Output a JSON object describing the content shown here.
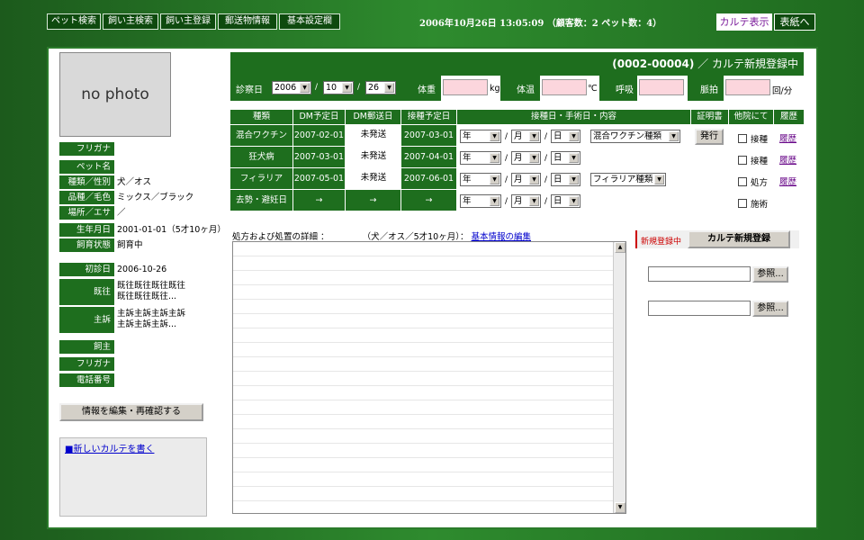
{
  "nav": {
    "tabs": [
      "ペット検索",
      "飼い主検索",
      "飼い主登録",
      "郵送物情報",
      "基本設定欄"
    ],
    "datetime": "2006年10月26日 13:05:09 （顧客数：2 ペット数：4）",
    "karte_view": "カルテ表示",
    "to_cover": "表紙へ"
  },
  "pet": {
    "photo_text": "no photo",
    "labels": [
      "フリガナ",
      "ペット名",
      "種類／性別",
      "品種／毛色",
      "場所／エサ",
      "生年月日",
      "飼育状態"
    ],
    "values": [
      "",
      "",
      "犬／オス",
      "ミックス／ブラック",
      "／",
      "2001-01-01（5才10ヶ月）",
      "飼育中"
    ],
    "visit_labels": [
      "初診日",
      "既往",
      "主訴"
    ],
    "first_visit": "2006-10-26",
    "history_lines": [
      "既往既往既往既往",
      "既往既往既往..."
    ],
    "complaint_lines": [
      "主訴主訴主訴主訴",
      "主訴主訴主訴..."
    ]
  },
  "owner": {
    "labels": [
      "飼主",
      "フリガナ",
      "電話番号"
    ]
  },
  "edit_button": "情報を編集・再確認する",
  "new_karte_link": "■新しいカルテを書く",
  "header": {
    "code": "(0002-00004)",
    "status": "／ カルテ新規登録中"
  },
  "vitals": {
    "date_label": "診察日",
    "year": "2006",
    "month": "10",
    "day": "26",
    "weight_label": "体重",
    "weight_unit": "kg",
    "temp_label": "体温",
    "temp_unit": "℃",
    "resp_label": "呼吸",
    "pulse_label": "脈拍",
    "pulse_unit": "回/分"
  },
  "table": {
    "headers": [
      "種類",
      "DM予定日",
      "DM郵送日",
      "接種予定日",
      "接種日・手術日・内容",
      "証明書",
      "他院にて",
      "履歴"
    ],
    "rows": [
      {
        "type": "混合ワクチン",
        "dm_planned": "2007-02-01",
        "dm_sent": "未発送",
        "vacc_planned": "2007-03-01",
        "extra": "混合ワクチン種類",
        "cert": "発行",
        "other": "接種",
        "history": "履歴"
      },
      {
        "type": "狂犬病",
        "dm_planned": "2007-03-01",
        "dm_sent": "未発送",
        "vacc_planned": "2007-04-01",
        "extra": "",
        "cert": "",
        "other": "接種",
        "history": "履歴"
      },
      {
        "type": "フィラリア",
        "dm_planned": "2007-05-01",
        "dm_sent": "未発送",
        "vacc_planned": "2007-06-01",
        "extra": "フィラリア種類",
        "cert": "",
        "other": "処方",
        "history": "履歴"
      },
      {
        "type": "去勢・避妊日",
        "dm_planned": "→",
        "dm_sent": "→",
        "vacc_planned": "→",
        "extra": "",
        "cert": "",
        "other": "施術",
        "history": ""
      }
    ],
    "date_y": "年",
    "date_m": "月",
    "date_d": "日"
  },
  "detail": {
    "label": "処方および処置の詳細 ：",
    "pet_info": "（犬／オス／5才10ヶ月）：",
    "edit_link": "基本情報の編集"
  },
  "side": {
    "new_status": "新規登録中",
    "register_button": "カルテ新規登録",
    "ref_button": "参照..."
  },
  "colors": {
    "accent_green": "#1e6e1e",
    "pink_input": "#fcd6dd",
    "link_blue": "#0000cc",
    "history_purple": "#6a0a8a",
    "status_red": "#cc0000"
  }
}
